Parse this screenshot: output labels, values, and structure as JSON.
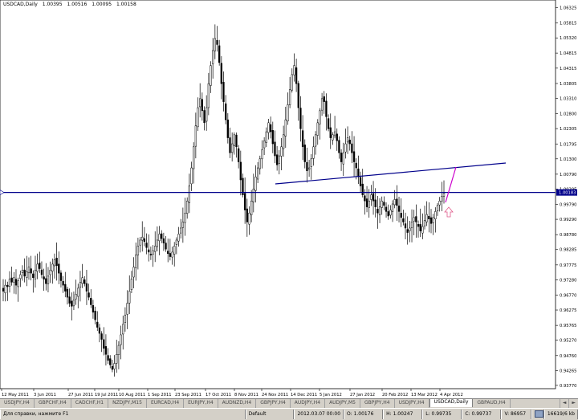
{
  "header": {
    "symbol": "USDCAD,Daily",
    "open": "1.00395",
    "high": "1.00516",
    "low": "1.00095",
    "close": "1.00158"
  },
  "current_price_label": "1.00183",
  "colors": {
    "candles": "#000000",
    "trendline": "#00008b",
    "horizontal_line": "#00008b",
    "price_label_bg": "#00008b",
    "projection": "#cc00cc",
    "arrow": "#e05a8a"
  },
  "chart_data": {
    "type": "candlestick",
    "y_ticks": [
      "1.06325",
      "1.05815",
      "1.05320",
      "1.04815",
      "1.04315",
      "1.03805",
      "1.03310",
      "1.02800",
      "1.02305",
      "1.01795",
      "1.01300",
      "1.00790",
      "1.00295",
      "0.99790",
      "0.99290",
      "0.98780",
      "0.98285",
      "0.97775",
      "0.97280",
      "0.96770",
      "0.96275",
      "0.95765",
      "0.95270",
      "0.94760",
      "0.94265",
      "0.93770"
    ],
    "x_ticks": [
      "12 May 2011",
      "3 Jun 2011",
      "27 Jun 2011",
      "19 Jul 2011",
      "10 Aug 2011",
      "1 Sep 2011",
      "23 Sep 2011",
      "17 Oct 2011",
      "8 Nov 2011",
      "24 Nov 2011",
      "14 Dec 2011",
      "5 Jan 2012",
      "27 Jan 2012",
      "20 Feb 2012",
      "13 Mar 2012",
      "4 Apr 2012"
    ],
    "closes": [
      0.969,
      0.971,
      0.9705,
      0.973,
      0.972,
      0.9735,
      0.971,
      0.9725,
      0.9745,
      0.976,
      0.974,
      0.9755,
      0.977,
      0.975,
      0.9735,
      0.976,
      0.978,
      0.9765,
      0.9745,
      0.973,
      0.9715,
      0.974,
      0.976,
      0.978,
      0.9795,
      0.9775,
      0.975,
      0.9725,
      0.971,
      0.969,
      0.967,
      0.965,
      0.964,
      0.966,
      0.968,
      0.97,
      0.972,
      0.9735,
      0.9715,
      0.969,
      0.967,
      0.9645,
      0.962,
      0.9595,
      0.957,
      0.955,
      0.953,
      0.95,
      0.948,
      0.946,
      0.9445,
      0.943,
      0.945,
      0.948,
      0.951,
      0.9545,
      0.958,
      0.961,
      0.965,
      0.969,
      0.973,
      0.977,
      0.981,
      0.984,
      0.986,
      0.987,
      0.9855,
      0.9835,
      0.982,
      0.981,
      0.9825,
      0.984,
      0.986,
      0.988,
      0.9865,
      0.985,
      0.983,
      0.9815,
      0.9805,
      0.982,
      0.984,
      0.986,
      0.988,
      0.99,
      0.992,
      0.995,
      0.999,
      1.004,
      1.01,
      1.017,
      1.024,
      1.03,
      1.033,
      1.029,
      1.025,
      1.03,
      1.038,
      1.044,
      1.049,
      1.053,
      1.051,
      1.045,
      1.038,
      1.032,
      1.026,
      1.02,
      1.015,
      1.018,
      1.021,
      1.017,
      1.012,
      1.006,
      1.001,
      0.996,
      0.992,
      0.995,
      0.999,
      1.003,
      1.007,
      1.01,
      1.013,
      1.016,
      1.019,
      1.022,
      1.025,
      1.022,
      1.018,
      1.014,
      1.011,
      1.014,
      1.017,
      1.021,
      1.026,
      1.031,
      1.036,
      1.041,
      1.044,
      1.038,
      1.03,
      1.023,
      1.017,
      1.012,
      1.009,
      1.01,
      1.013,
      1.017,
      1.021,
      1.025,
      1.029,
      1.033,
      1.032,
      1.027,
      1.023,
      1.02,
      1.021,
      1.022,
      1.019,
      1.015,
      1.012,
      1.015,
      1.018,
      1.02,
      1.018,
      1.015,
      1.012,
      1.01,
      1.007,
      1.004,
      1.001,
      0.999,
      0.997,
      0.999,
      1.001,
      0.999,
      0.997,
      0.995,
      0.997,
      0.999,
      0.9975,
      0.9955,
      0.994,
      0.996,
      0.998,
      0.9995,
      0.9975,
      0.9955,
      0.9935,
      0.992,
      0.99,
      0.9885,
      0.99,
      0.992,
      0.9935,
      0.992,
      0.9905,
      0.989,
      0.9905,
      0.9925,
      0.9945,
      0.993,
      0.9915,
      0.9935,
      0.9955,
      0.9975,
      0.999,
      1.0005,
      1.0016
    ]
  },
  "tabs": [
    {
      "label": "USDJPY,H4",
      "active": false
    },
    {
      "label": "GBPCHF,H4",
      "active": false
    },
    {
      "label": "CADCHF,H1",
      "active": false
    },
    {
      "label": "NZDJPY,M15",
      "active": false
    },
    {
      "label": "EURCAD,H4",
      "active": false
    },
    {
      "label": "EURJPY,H4",
      "active": false
    },
    {
      "label": "AUDNZD,H4",
      "active": false
    },
    {
      "label": "GBPJPY,H4",
      "active": false
    },
    {
      "label": "AUDJPY,H4",
      "active": false
    },
    {
      "label": "AUDJPY,M5",
      "active": false
    },
    {
      "label": "GBPJPY,H4",
      "active": false
    },
    {
      "label": "USDJPY,H4",
      "active": false
    },
    {
      "label": "USDCAD,Daily",
      "active": true
    },
    {
      "label": "GBPAUD,H4",
      "active": false
    }
  ],
  "tab_scroll": {
    "left": "◄",
    "right": "►"
  },
  "status": {
    "help": "Для справки, нажмите F1",
    "profile": "Default",
    "datetime": "2012.03.07 00:00",
    "open": "O: 1.00176",
    "high": "H: 1.00247",
    "low": "L: 0.99735",
    "close": "C: 0.99737",
    "volume": "V: 86957",
    "traffic": "16619/6 kb"
  }
}
